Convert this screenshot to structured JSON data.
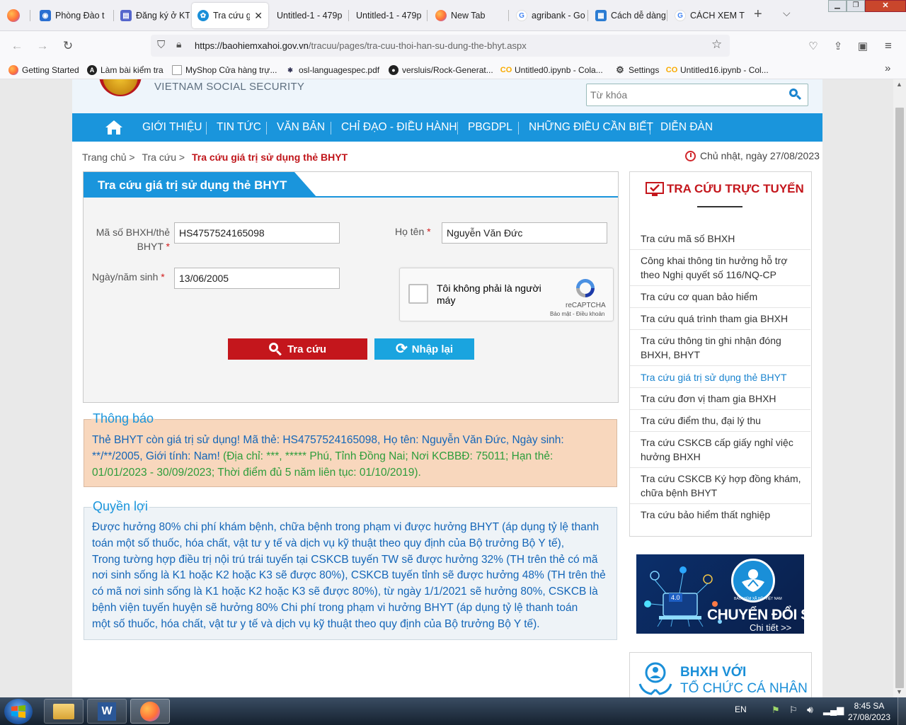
{
  "browser": {
    "tabs": [
      {
        "title": "Phòng Đào t",
        "active": false
      },
      {
        "title": "Đăng ký ở KT",
        "active": false
      },
      {
        "title": "Tra cứu gi",
        "active": true
      },
      {
        "title": "Untitled-1 - 479p",
        "active": false
      },
      {
        "title": "Untitled-1 - 479p",
        "active": false
      },
      {
        "title": "New Tab",
        "active": false
      },
      {
        "title": "agribank - Go",
        "active": false
      },
      {
        "title": "Cách dễ dàng",
        "active": false
      },
      {
        "title": "CÁCH XEM T",
        "active": false
      }
    ],
    "url_host": "https://baohiemxahoi.gov.vn",
    "url_path": "/tracuu/pages/tra-cuu-thoi-han-su-dung-the-bhyt.aspx",
    "bookmarks": [
      "Getting Started",
      "Làm bài kiểm tra",
      "MyShop Cửa hàng trự...",
      "osl-languagespec.pdf",
      "versluis/Rock-Generat...",
      "Untitled0.ipynb - Cola...",
      "Settings",
      "Untitled16.ipynb - Col..."
    ]
  },
  "site": {
    "org_name": "VIETNAM SOCIAL SECURITY",
    "search_placeholder": "Từ khóa",
    "menu": [
      "GIỚI THIỆU",
      "TIN TỨC",
      "VĂN BẢN",
      "CHỈ ĐẠO - ĐIỀU HÀNH",
      "PBGDPL",
      "NHỮNG ĐIỀU CẦN BIẾT",
      "DIỄN ĐÀN"
    ],
    "breadcrumb": {
      "home": "Trang chủ >",
      "lookup": "Tra cứu >",
      "current": "Tra cứu giá trị sử dụng thẻ BHYT"
    },
    "date": "Chủ nhật, ngày 27/08/2023"
  },
  "form": {
    "title": "Tra cứu giá trị sử dụng thẻ BHYT",
    "code_label_1": "Mã số BHXH/thẻ",
    "code_label_2": "BHYT",
    "code_value": "HS4757524165098",
    "name_label": "Họ tên",
    "name_value": "Nguyễn Văn Đức",
    "dob_label": "Ngày/năm sinh",
    "dob_value": "13/06/2005",
    "required_mark": "*",
    "captcha_line1": "Tôi không phải là người",
    "captcha_line2": "máy",
    "captcha_brand": "reCAPTCHA",
    "captcha_terms": "Bảo mật - Điều khoản",
    "search_button": "Tra cứu",
    "reset_button": "Nhập lại"
  },
  "notice": {
    "legend": "Thông báo",
    "line1_blue": "Thẻ BHYT còn giá trị sử dụng! Mã thẻ: HS4757524165098, Họ tên: Nguyễn Văn Đức, Ngày sinh:",
    "line2_blue": "**/**/2005, Giới tính: Nam!",
    "line2_green": " (Địa chỉ: ***, ***** Phú, Tỉnh Đồng Nai; Nơi KCBBĐ: 75011; Hạn thẻ:",
    "line3_green": "01/01/2023 - 30/09/2023; Thời điểm đủ 5 năm liên tục: 01/10/2019).",
    "colors": {
      "blue": "#1466b8",
      "green": "#2e9d3c",
      "background": "#f8d7bd"
    }
  },
  "benefits": {
    "legend": "Quyền lợi",
    "lines": [
      "Được hưởng 80% chi phí khám bệnh, chữa bệnh trong phạm vi được hưởng BHYT (áp dụng tỷ lệ thanh",
      "toán một số thuốc, hóa chất, vật tư y tế và dịch vụ kỹ thuật theo quy định của Bộ trưởng Bộ Y tế),",
      "Trong tường hợp điều trị nội trú trái tuyến tại CSKCB tuyến TW sẽ được hưởng 32% (TH trên thẻ có mã",
      "nơi sinh sống là K1 hoặc K2 hoặc K3 sẽ được 80%), CSKCB tuyến tỉnh sẽ được hưởng 48% (TH trên thẻ",
      "có mã nơi sinh sống là K1 hoặc K2 hoặc K3 sẽ được 80%), từ ngày 1/1/2021 sẽ hưởng 80%, CSKCB là",
      "bệnh viện tuyến huyện sẽ hưởng 80% Chi phí trong phạm vi hưởng BHYT (áp dụng tỷ lệ thanh toán",
      "một số thuốc, hóa chất, vật tư y tế và dịch vụ kỹ thuật theo quy định của Bộ trưởng Bộ Y tế)."
    ]
  },
  "sidebar": {
    "title": "TRA CỨU TRỰC TUYẾN",
    "items": [
      {
        "lines": [
          "Tra cứu mã số BHXH"
        ]
      },
      {
        "lines": [
          "Công khai thông tin hưởng hỗ trợ",
          "theo Nghị quyết số 116/NQ-CP"
        ]
      },
      {
        "lines": [
          "Tra cứu cơ quan bảo hiểm"
        ]
      },
      {
        "lines": [
          "Tra cứu quá trình tham gia BHXH"
        ]
      },
      {
        "lines": [
          "Tra cứu thông tin ghi nhận đóng",
          "BHXH, BHYT"
        ]
      },
      {
        "lines": [
          "Tra cứu giá trị sử dụng thẻ BHYT"
        ]
      },
      {
        "lines": [
          "Tra cứu đơn vị tham gia BHXH"
        ]
      },
      {
        "lines": [
          "Tra cứu điểm thu, đại lý thu"
        ]
      },
      {
        "lines": [
          "Tra cứu CSKCB cấp giấy nghỉ việc",
          "hưởng BHXH"
        ]
      },
      {
        "lines": [
          "Tra cứu CSKCB Ký hợp đồng khám,",
          "chữa bệnh BHYT"
        ]
      },
      {
        "lines": [
          "Tra cứu bảo hiểm thất nghiệp"
        ]
      }
    ],
    "banner1_title": "CHUYỂN ĐỔI SỐ",
    "banner1_link": "Chi tiết >>",
    "banner1_badge": "4.0",
    "banner1_logo_text": "BẢO HIỂM XÃ HỘI VIỆT NAM",
    "banner2_line1": "BHXH VỚI",
    "banner2_line2": "TỔ CHỨC CÁ NHÂN"
  },
  "taskbar": {
    "lang": "EN",
    "time": "8:45 SA",
    "date": "27/08/2023"
  }
}
